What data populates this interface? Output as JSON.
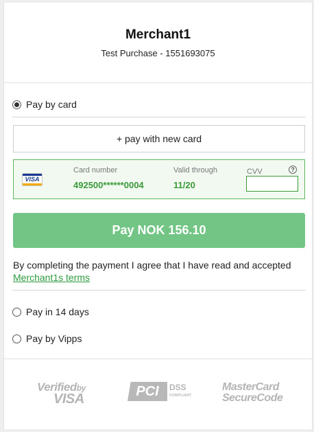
{
  "header": {
    "merchant_name": "Merchant1",
    "purchase_description": "Test Purchase - 1551693075"
  },
  "payment_methods": {
    "card": {
      "label": "Pay by card",
      "selected": true
    },
    "new_card_button": "+ pay with new card",
    "saved_card": {
      "brand": "VISA",
      "card_number_label": "Card number",
      "card_number": "492500******0004",
      "valid_through_label": "Valid through",
      "valid_through": "11/20",
      "cvv_label": "CVV",
      "cvv_value": "",
      "help_icon": "?"
    },
    "pay_button": "Pay NOK 156.10",
    "terms_text": "By completing the payment I agree that I have read and accepted",
    "terms_link": "Merchant1s terms",
    "pay_later": {
      "label": "Pay in 14 days",
      "selected": false
    },
    "vipps": {
      "label": "Pay by Vipps",
      "selected": false
    }
  },
  "security_badges": {
    "verified_by_visa_line1": "Verified",
    "verified_by_visa_by": "by",
    "verified_by_visa_line2": "VISA",
    "pci_mark": "PCI",
    "pci_dss": "DSS",
    "pci_compliant": "COMPLIANT",
    "mastercard_line1": "MasterCard",
    "mastercard_line2": "SecureCode"
  },
  "colors": {
    "accent_green": "#72c584",
    "link_green": "#2b9b3d",
    "card_border": "#5cb85c"
  }
}
